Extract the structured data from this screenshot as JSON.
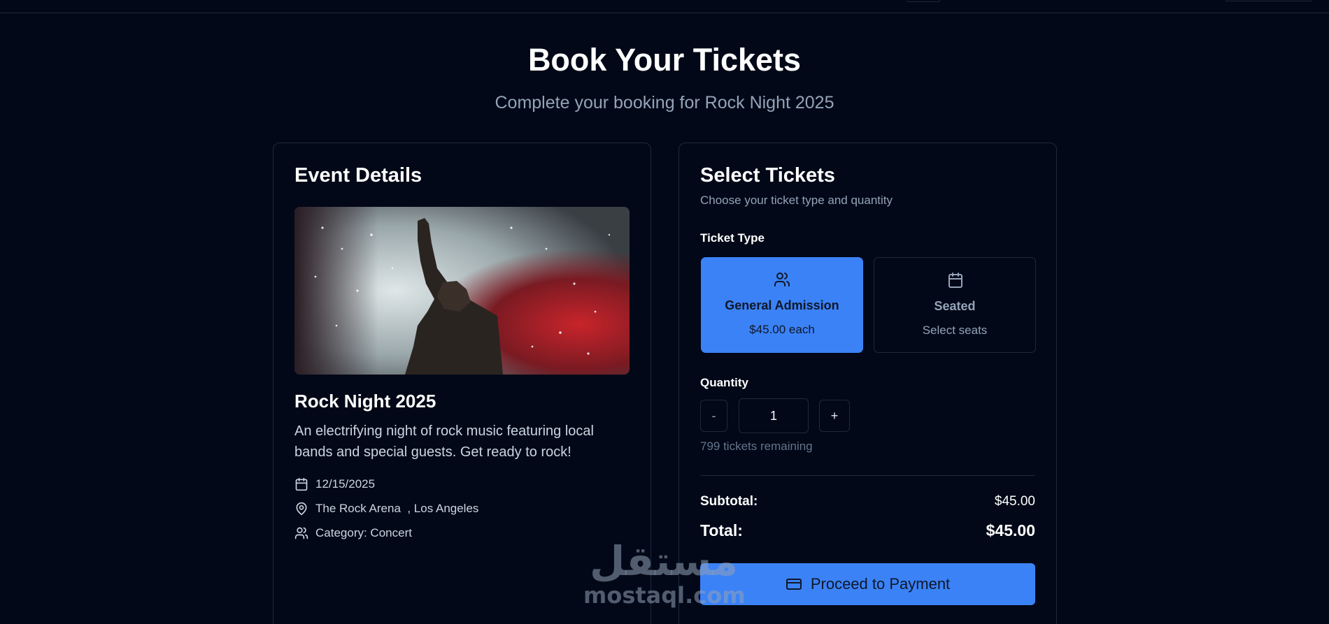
{
  "header": {
    "title": "Book Your Tickets",
    "subtitle": "Complete your booking for Rock Night 2025"
  },
  "event_details": {
    "heading": "Event Details",
    "image_icon": "concert-photo",
    "name": "Rock Night 2025",
    "description": "An electrifying night of rock music featuring local bands and special guests. Get ready to rock!",
    "date": "12/15/2025",
    "location": "The Rock Arena  , Los Angeles",
    "category": "Category: Concert"
  },
  "select_tickets": {
    "heading": "Select Tickets",
    "subheading": "Choose your ticket type and quantity",
    "ticket_type_label": "Ticket Type",
    "options": [
      {
        "name": "General Admission",
        "detail": "$45.00 each",
        "icon": "users-icon",
        "selected": true
      },
      {
        "name": "Seated",
        "detail": "Select seats",
        "icon": "calendar-icon",
        "selected": false
      }
    ],
    "quantity_label": "Quantity",
    "minus_label": "-",
    "plus_label": "+",
    "quantity_value": "1",
    "remaining": "799 tickets remaining",
    "subtotal_label": "Subtotal:",
    "subtotal_value": "$45.00",
    "total_label": "Total:",
    "total_value": "$45.00",
    "proceed_label": "Proceed to Payment"
  },
  "watermark": {
    "arabic": "مستقل",
    "latin": "mostaql.com"
  },
  "colors": {
    "background": "#020817",
    "accent": "#3b82f6",
    "border": "#1e293b",
    "muted_text": "#94a3b8"
  }
}
